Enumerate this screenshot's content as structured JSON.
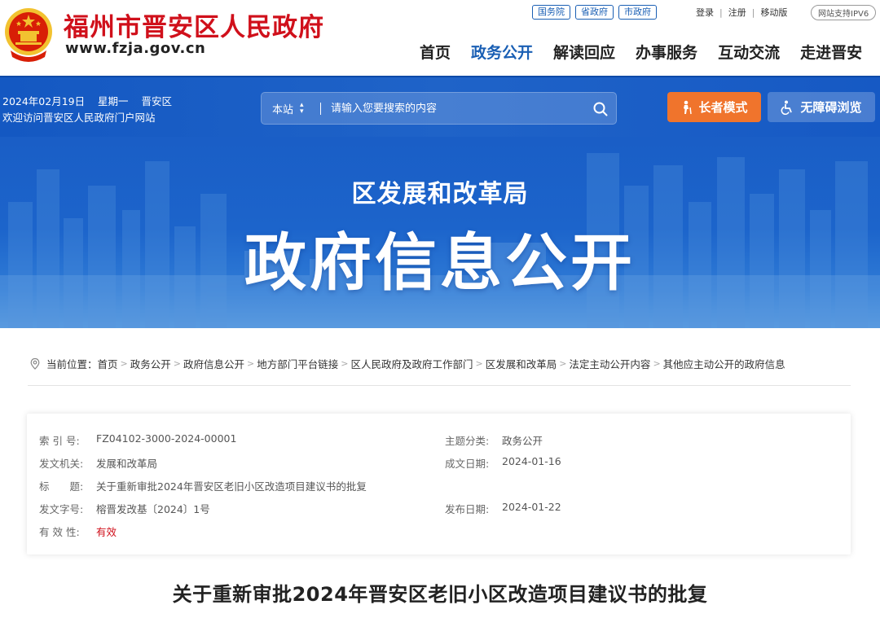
{
  "header": {
    "site_name": "福州市晋安区人民政府",
    "site_url": "www.fzja.gov.cn",
    "gov_links": [
      "国务院",
      "省政府",
      "市政府"
    ],
    "user_links": [
      "登录",
      "注册",
      "移动版"
    ],
    "ipv6": "网站支持IPV6",
    "nav": [
      {
        "label": "首页",
        "active": false
      },
      {
        "label": "政务公开",
        "active": true
      },
      {
        "label": "解读回应",
        "active": false
      },
      {
        "label": "办事服务",
        "active": false
      },
      {
        "label": "互动交流",
        "active": false
      },
      {
        "label": "走进晋安",
        "active": false
      }
    ]
  },
  "topbar": {
    "date": "2024年02月19日",
    "weekday": "星期一",
    "district": "晋安区",
    "welcome": "欢迎访问晋安区人民政府门户网站",
    "search_scope": "本站",
    "search_placeholder": "请输入您要搜索的内容",
    "elder_mode": "长者模式",
    "accessibility": "无障碍浏览"
  },
  "banner": {
    "department": "区发展和改革局",
    "title": "政府信息公开"
  },
  "breadcrumb": {
    "prefix": "当前位置：",
    "items": [
      "首页",
      "政务公开",
      "政府信息公开",
      "地方部门平台链接",
      "区人民政府及政府工作部门",
      "区发展和改革局",
      "法定主动公开内容",
      "其他应主动公开的政府信息"
    ]
  },
  "meta": {
    "index_label": "索 引 号:",
    "index_value": "FZ04102-3000-2024-00001",
    "topic_label": "主题分类:",
    "topic_value": "政务公开",
    "issuer_label": "发文机关:",
    "issuer_value": "发展和改革局",
    "created_label": "成文日期:",
    "created_value": "2024-01-16",
    "title_label": "标　　题:",
    "title_value": "关于重新审批2024年晋安区老旧小区改造项目建议书的批复",
    "docno_label": "发文字号:",
    "docno_value": "榕晋发改基〔2024〕1号",
    "published_label": "发布日期:",
    "published_value": "2024-01-22",
    "validity_label": "有 效 性:",
    "validity_value": "有效"
  },
  "article": {
    "title": "关于重新审批2024年晋安区老旧小区改造项目建议书的批复"
  },
  "colors": {
    "brand_red": "#d0101b",
    "brand_blue": "#1a5fb4",
    "elder_orange": "#f0742c"
  }
}
